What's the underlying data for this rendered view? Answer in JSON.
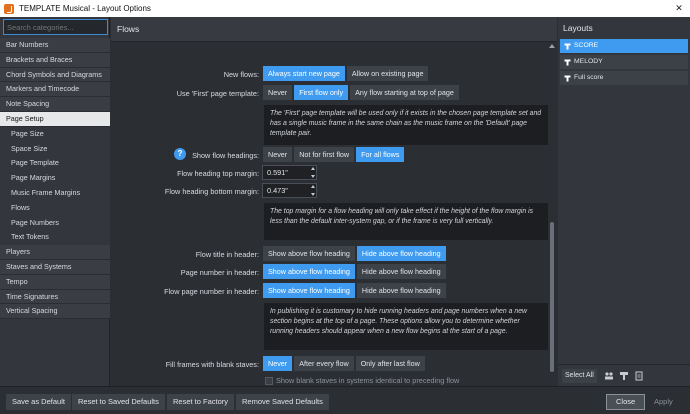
{
  "window": {
    "title": "TEMPLATE Musical - Layout Options"
  },
  "sidebar": {
    "search_placeholder": "Search categories...",
    "categories": [
      {
        "label": "Bar Numbers"
      },
      {
        "label": "Brackets and Braces"
      },
      {
        "label": "Chord Symbols and Diagrams"
      },
      {
        "label": "Markers and Timecode"
      },
      {
        "label": "Note Spacing"
      },
      {
        "label": "Page Setup",
        "selected": true
      },
      {
        "label": "Page Size",
        "sub": true
      },
      {
        "label": "Space Size",
        "sub": true
      },
      {
        "label": "Page Template",
        "sub": true
      },
      {
        "label": "Page Margins",
        "sub": true
      },
      {
        "label": "Music Frame Margins",
        "sub": true
      },
      {
        "label": "Flows",
        "sub": true
      },
      {
        "label": "Page Numbers",
        "sub": true
      },
      {
        "label": "Text Tokens",
        "sub": true
      },
      {
        "label": "Players"
      },
      {
        "label": "Staves and Systems"
      },
      {
        "label": "Tempo"
      },
      {
        "label": "Time Signatures"
      },
      {
        "label": "Vertical Spacing"
      }
    ]
  },
  "main": {
    "section_title": "Flows",
    "new_flows": {
      "label": "New flows:",
      "options": [
        "Always start new page",
        "Allow on existing page"
      ],
      "selected": 0
    },
    "first_page_template": {
      "label": "Use 'First' page template:",
      "options": [
        "Never",
        "First flow only",
        "Any flow starting at top of page"
      ],
      "selected": 1
    },
    "info1": "The 'First' page template will be used only if it exists in the chosen page template set and has a single music frame in the same chain as the music frame on the 'Default' page template pair.",
    "show_flow_headings": {
      "label": "Show flow headings:",
      "options": [
        "Never",
        "Not for first flow",
        "For all flows"
      ],
      "selected": 2
    },
    "heading_top_margin": {
      "label": "Flow heading top margin:",
      "value": "0.591\""
    },
    "heading_bottom_margin": {
      "label": "Flow heading bottom margin:",
      "value": "0.473\""
    },
    "info2": "The top margin for a flow heading will only take effect if the height of the flow margin is less than the default inter-system gap, or if the frame is very full vertically.",
    "flow_title_header": {
      "label": "Flow title in header:",
      "options": [
        "Show above flow heading",
        "Hide above flow heading"
      ],
      "selected": 1
    },
    "page_number_header": {
      "label": "Page number in header:",
      "options": [
        "Show above flow heading",
        "Hide above flow heading"
      ],
      "selected": 0
    },
    "flow_page_number_header": {
      "label": "Flow page number in header:",
      "options": [
        "Show above flow heading",
        "Hide above flow heading"
      ],
      "selected": 0
    },
    "info3": "In publishing it is customary to hide running headers and page numbers when a new section begins at the top of a page. These options allow you to determine whether running headers should appear when a new flow begins at the start of a page.",
    "fill_frames": {
      "label": "Fill frames with blank staves:",
      "options": [
        "Never",
        "After every flow",
        "Only after last flow"
      ],
      "selected": 0
    },
    "blank_staves_checkbox": "Show blank staves in systems identical to preceding flow"
  },
  "layouts": {
    "title": "Layouts",
    "items": [
      {
        "label": "SCORE",
        "selected": true
      },
      {
        "label": "MELODY"
      },
      {
        "label": "Full score"
      }
    ],
    "select_all": "Select All"
  },
  "footer": {
    "save_default": "Save as Default",
    "reset_saved": "Reset to Saved Defaults",
    "reset_factory": "Reset to Factory",
    "remove_saved": "Remove Saved Defaults",
    "close": "Close",
    "apply": "Apply"
  },
  "colors": {
    "accent": "#3f9bf0",
    "background": "#2b2e33",
    "info_box": "#1c1e22"
  }
}
